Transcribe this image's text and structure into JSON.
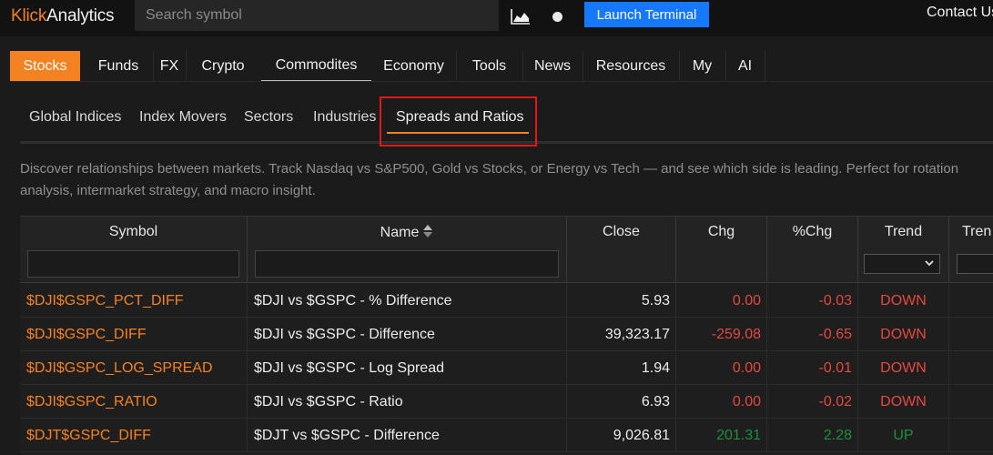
{
  "header": {
    "logo_part1": "Klick",
    "logo_part2": "Analytics",
    "search_placeholder": "Search symbol",
    "launch_label": "Launch Terminal",
    "contact_label": "Contact Us",
    "icons": [
      "area-chart-icon",
      "dot-icon"
    ]
  },
  "main_nav": {
    "tabs": [
      "Stocks",
      "Funds",
      "FX",
      "Crypto",
      "Commodites",
      "Economy",
      "Tools",
      "News",
      "Resources",
      "My",
      "AI"
    ],
    "active": "Stocks",
    "hovered": "Commodites"
  },
  "sub_nav": {
    "tabs": [
      "Global Indices",
      "Index Movers",
      "Sectors",
      "Industries",
      "Spreads and Ratios"
    ],
    "active": "Spreads and Ratios"
  },
  "description": {
    "line1": "Discover relationships between markets. Track Nasdaq vs S&P500, Gold vs Stocks, or Energy vs Tech — and see which side is leading. Perfect for rotation",
    "line2": "analysis, intermarket strategy, and macro insight."
  },
  "table": {
    "columns": {
      "symbol": "Symbol",
      "name": "Name",
      "close": "Close",
      "chg": "Chg",
      "pchg": "%Chg",
      "trend": "Trend",
      "trend2": "Tren"
    },
    "rows": [
      {
        "symbol": "$DJI$GSPC_PCT_DIFF",
        "name": "$DJI vs $GSPC - % Difference",
        "close": "5.93",
        "chg": "0.00",
        "pchg": "-0.03",
        "trend": "DOWN"
      },
      {
        "symbol": "$DJI$GSPC_DIFF",
        "name": "$DJI vs $GSPC - Difference",
        "close": "39,323.17",
        "chg": "-259.08",
        "pchg": "-0.65",
        "trend": "DOWN"
      },
      {
        "symbol": "$DJI$GSPC_LOG_SPREAD",
        "name": "$DJI vs $GSPC - Log Spread",
        "close": "1.94",
        "chg": "0.00",
        "pchg": "-0.01",
        "trend": "DOWN"
      },
      {
        "symbol": "$DJI$GSPC_RATIO",
        "name": "$DJI vs $GSPC - Ratio",
        "close": "6.93",
        "chg": "0.00",
        "pchg": "-0.02",
        "trend": "DOWN"
      },
      {
        "symbol": "$DJT$GSPC_DIFF",
        "name": "$DJT vs $GSPC - Difference",
        "close": "9,026.81",
        "chg": "201.31",
        "pchg": "2.28",
        "trend": "UP"
      }
    ]
  },
  "colors": {
    "accent": "#f58220",
    "primary_button": "#1677ff",
    "negative": "#e5483f",
    "positive": "#1e8f3a",
    "highlight_box": "#e01919"
  }
}
